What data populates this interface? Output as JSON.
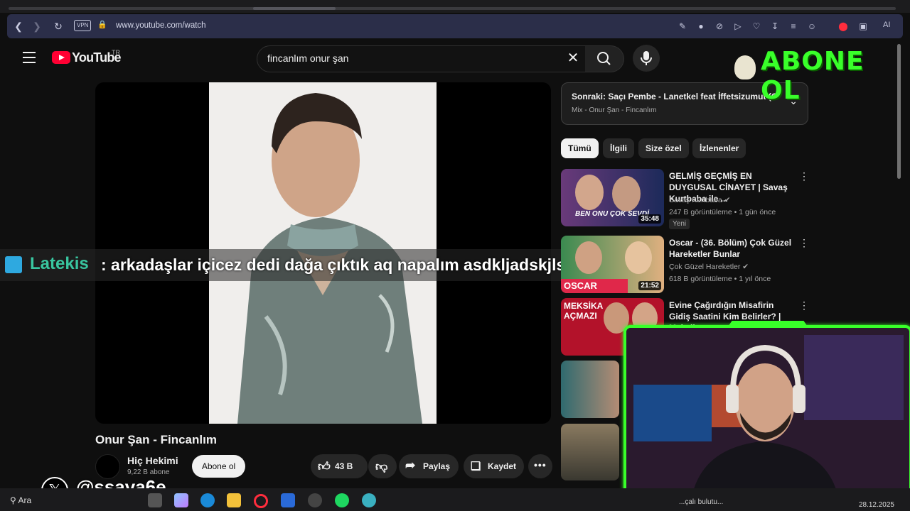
{
  "browser": {
    "vpn_label": "VPN",
    "url": "www.youtube.com/watch",
    "ai_label": "AI"
  },
  "header": {
    "logo_text": "YouTube",
    "country_code": "TR",
    "search_value": "fincanlım onur şan"
  },
  "overlay": {
    "chat_user": "Latekis",
    "chat_message": ": arkadaşlar içicez dedi dağa çıktık aq napalım asdkljadskjlsad",
    "abone_text": "ABONE OL",
    "x_handle": "@ssava6e"
  },
  "video": {
    "title": "Onur Şan - Fincanlım",
    "channel_name": "Hiç Hekimi",
    "channel_subs": "9,22 B abone",
    "subscribe_label": "Abone ol",
    "like_count": "43 B",
    "share_label": "Paylaş",
    "save_label": "Kaydet"
  },
  "sidebar": {
    "up_next_title": "Sonraki: Saçı Pembe - Lanetkel feat İffetsizumut (O...",
    "up_next_sub": "Mix - Onur Şan - Fincanlım",
    "chips": [
      "Tümü",
      "İlgili",
      "Size özel",
      "İzlenenler"
    ],
    "recommendations": [
      {
        "title": "GELMİŞ GEÇMİŞ EN DUYGUSAL CİNAYET | Savaş Kurtbaba ile ...",
        "channel": "Savaş Kurtbaba",
        "meta": "247 B görüntüleme • 1 gün önce",
        "badge": "Yeni",
        "duration": "35:48",
        "thumb_text": "BEN ONU ÇOK SEVDİ"
      },
      {
        "title": "Oscar - (36. Bölüm) Çok Güzel Hareketler Bunlar",
        "channel": "Çok Güzel Hareketler",
        "meta": "618 B görüntüleme • 1 yıl önce",
        "duration": "21:52",
        "thumb_text": "OSCAR"
      },
      {
        "title": "Evine Çağırdığın Misafirin Gidiş Saatini Kim Belirler? | Meksika...",
        "thumb_text": "MEKSİKA AÇMAZI"
      }
    ]
  },
  "taskbar": {
    "search_label": "Ara",
    "date": "28.12.2025",
    "tray_text": "...çalı bulutu..."
  },
  "colors": {
    "youtube_red": "#ff0033",
    "overlay_green": "#39ff2a",
    "chat_user_color": "#39c6a0"
  }
}
